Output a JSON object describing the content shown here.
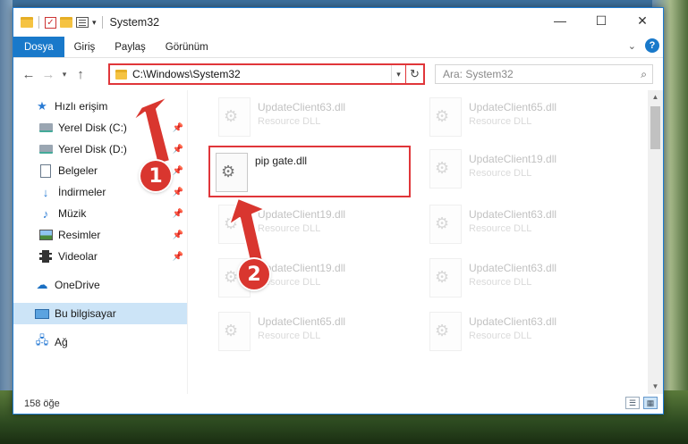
{
  "window": {
    "title": "System32"
  },
  "ribbon": {
    "tabs": [
      "Dosya",
      "Giriş",
      "Paylaş",
      "Görünüm"
    ]
  },
  "nav": {
    "address_path": "C:\\Windows\\System32",
    "search_placeholder": "Ara: System32"
  },
  "sidebar": {
    "items": [
      {
        "label": "Hızlı erişim",
        "icon": "star-icon"
      },
      {
        "label": "Yerel Disk (C:)",
        "icon": "drive-icon",
        "pinned": true
      },
      {
        "label": "Yerel Disk (D:)",
        "icon": "drive-icon",
        "pinned": true
      },
      {
        "label": "Belgeler",
        "icon": "document-icon",
        "pinned": true
      },
      {
        "label": "İndirmeler",
        "icon": "download-icon",
        "pinned": true
      },
      {
        "label": "Müzik",
        "icon": "music-icon",
        "pinned": true
      },
      {
        "label": "Resimler",
        "icon": "picture-icon",
        "pinned": true
      },
      {
        "label": "Videolar",
        "icon": "video-icon",
        "pinned": true
      },
      {
        "label": "OneDrive",
        "icon": "cloud-icon"
      },
      {
        "label": "Bu bilgisayar",
        "icon": "computer-icon",
        "selected": true
      },
      {
        "label": "Ağ",
        "icon": "network-icon"
      }
    ]
  },
  "files": {
    "highlighted": {
      "name": "pip gate.dll"
    },
    "background": [
      {
        "name": "UpdateClient63.dll",
        "desc": "Resource DLL"
      },
      {
        "name": "UpdateClient65.dll",
        "desc": "Resource DLL"
      },
      {
        "name": "UpdateClient19.dll",
        "desc": "Resource DLL"
      },
      {
        "name": "UpdateClient19.dll",
        "desc": "Resource DLL"
      },
      {
        "name": "UpdateClient63.dll",
        "desc": "Resource DLL"
      },
      {
        "name": "UpdateClient19.dll",
        "desc": "Resource DLL"
      },
      {
        "name": "UpdateClient63.dll",
        "desc": "Resource DLL"
      },
      {
        "name": "UpdateClient65.dll",
        "desc": "Resource DLL"
      },
      {
        "name": "UpdateClient63.dll",
        "desc": "Resource DLL"
      }
    ]
  },
  "status": {
    "item_count": "158 öğe"
  },
  "annotations": {
    "badge1": "1",
    "badge2": "2",
    "color": "#d9362f"
  }
}
